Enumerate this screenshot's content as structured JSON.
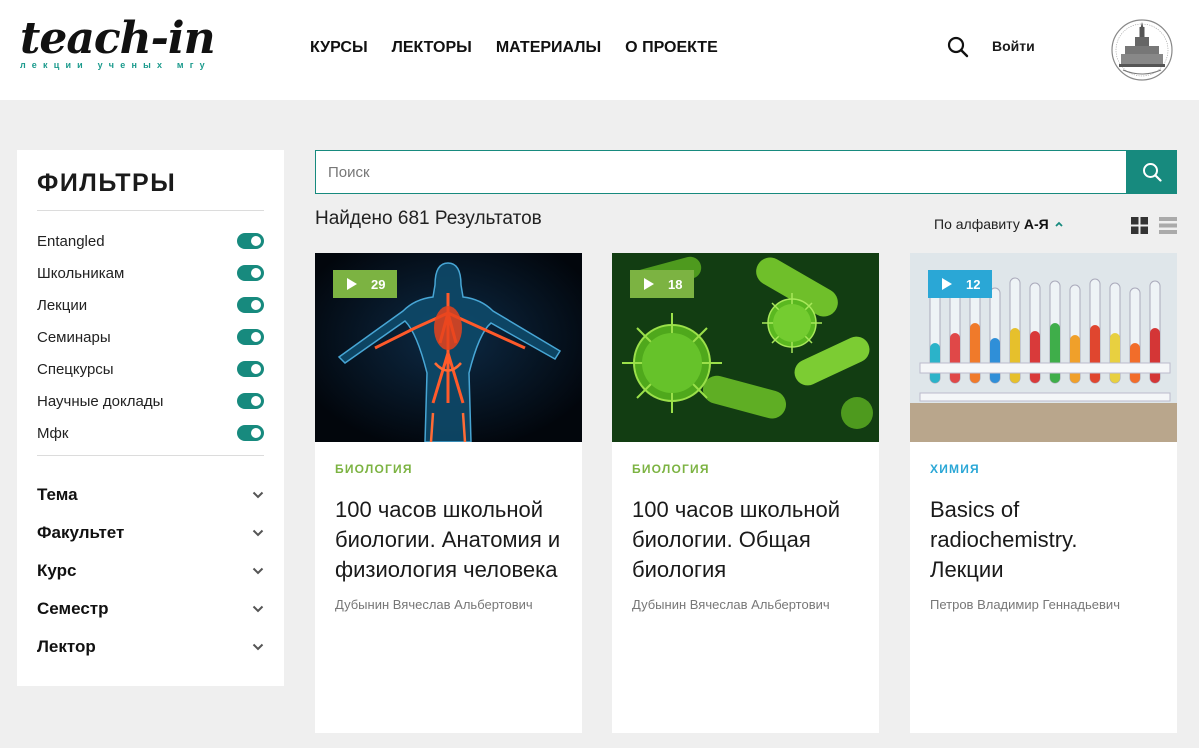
{
  "header": {
    "logo_text": "teach-in",
    "logo_subtitle": "лекции ученых мгу",
    "nav": [
      "КУРСЫ",
      "ЛЕКТОРЫ",
      "МАТЕРИАЛЫ",
      "О ПРОЕКТЕ"
    ],
    "login_label": "Войти",
    "search_icon": "search-icon",
    "crest_icon": "msu-crest-logo"
  },
  "filters": {
    "title": "ФИЛЬТРЫ",
    "toggles": [
      {
        "label": "Entangled",
        "on": true
      },
      {
        "label": "Школьникам",
        "on": true
      },
      {
        "label": "Лекции",
        "on": true
      },
      {
        "label": "Семинары",
        "on": true
      },
      {
        "label": "Спецкурсы",
        "on": true
      },
      {
        "label": "Научные доклады",
        "on": true
      },
      {
        "label": "Мфк",
        "on": true
      }
    ],
    "accordions": [
      "Тема",
      "Факультет",
      "Курс",
      "Семестр",
      "Лектор"
    ]
  },
  "search": {
    "placeholder": "Поиск",
    "value": ""
  },
  "results": {
    "count_text": "Найдено 681 Результатов",
    "sort_prefix": "По алфавиту",
    "sort_value": "А-Я"
  },
  "colors": {
    "accent": "#178a7e",
    "biology": "#7cb342",
    "chemistry": "#2aa7d6"
  },
  "cards": [
    {
      "count": "29",
      "category": "БИОЛОГИЯ",
      "category_color": "#7cb342",
      "title": "100 часов школьной биологии. Анатомия и физиология человека",
      "author": "Дубынин Вячеслав Альбертович"
    },
    {
      "count": "18",
      "category": "БИОЛОГИЯ",
      "category_color": "#7cb342",
      "title": "100 часов школьной биологии. Общая биология",
      "author": "Дубынин Вячеслав Альбертович"
    },
    {
      "count": "12",
      "category": "ХИМИЯ",
      "category_color": "#2aa7d6",
      "title": "Basics of radiochemistry. Лекции",
      "author": "Петров Владимир Геннадьевич"
    }
  ]
}
